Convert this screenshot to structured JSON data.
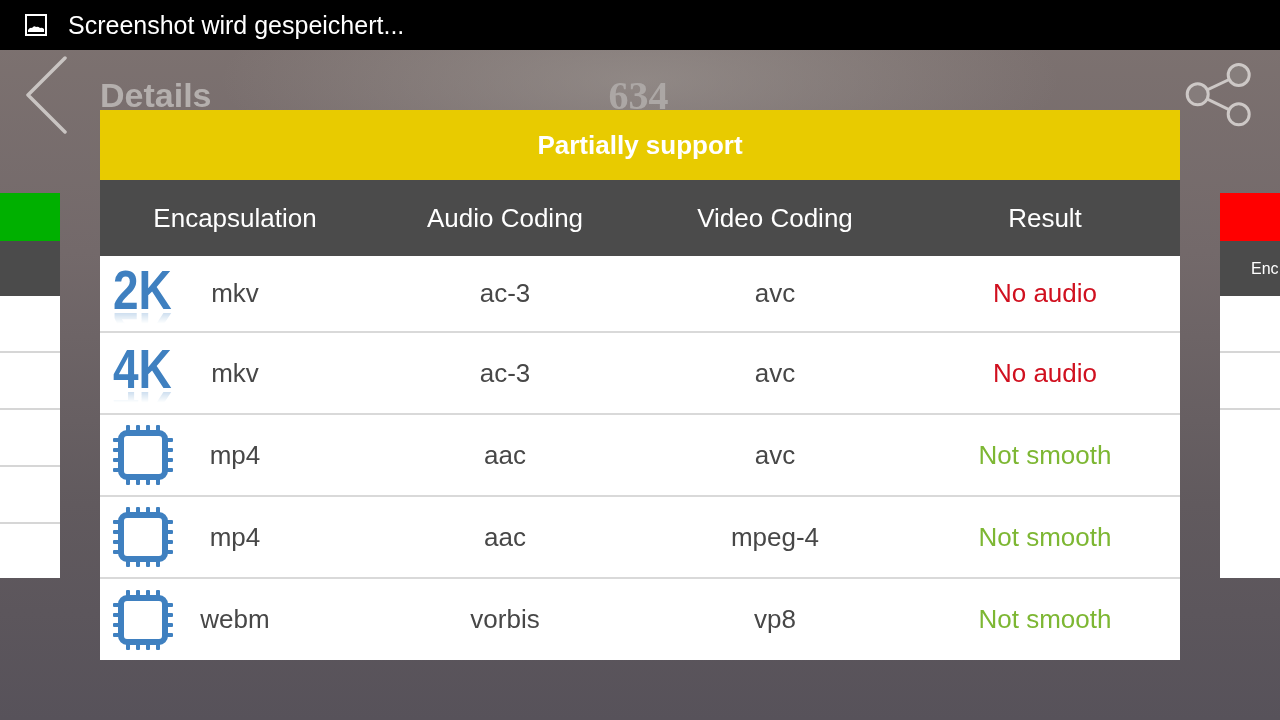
{
  "status_bar": {
    "notification": "Screenshot wird gespeichert..."
  },
  "app_bar": {
    "title": "Details",
    "count": "634"
  },
  "background_cards": [
    {
      "color": "#00b000"
    },
    {
      "color": "#ff0000",
      "header": "Enc"
    }
  ],
  "dialog": {
    "title": "Partially support",
    "columns": [
      "Encapsulation",
      "Audio Coding",
      "Video Coding",
      "Result"
    ],
    "rows": [
      {
        "format": {
          "kind": "resolution",
          "label": "2K"
        },
        "encapsulation": "mkv",
        "audio_coding": "ac-3",
        "video_coding": "avc",
        "result": {
          "text": "No audio",
          "color": "#d0101f"
        }
      },
      {
        "format": {
          "kind": "resolution",
          "label": "4K"
        },
        "encapsulation": "mkv",
        "audio_coding": "ac-3",
        "video_coding": "avc",
        "result": {
          "text": "No audio",
          "color": "#d0101f"
        }
      },
      {
        "format": {
          "kind": "chip"
        },
        "encapsulation": "mp4",
        "audio_coding": "aac",
        "video_coding": "avc",
        "result": {
          "text": "Not smooth",
          "color": "#7db733"
        }
      },
      {
        "format": {
          "kind": "chip"
        },
        "encapsulation": "mp4",
        "audio_coding": "aac",
        "video_coding": "mpeg-4",
        "result": {
          "text": "Not smooth",
          "color": "#7db733"
        }
      },
      {
        "format": {
          "kind": "chip"
        },
        "encapsulation": "webm",
        "audio_coding": "vorbis",
        "video_coding": "vp8",
        "result": {
          "text": "Not smooth",
          "color": "#7db733"
        }
      }
    ]
  }
}
